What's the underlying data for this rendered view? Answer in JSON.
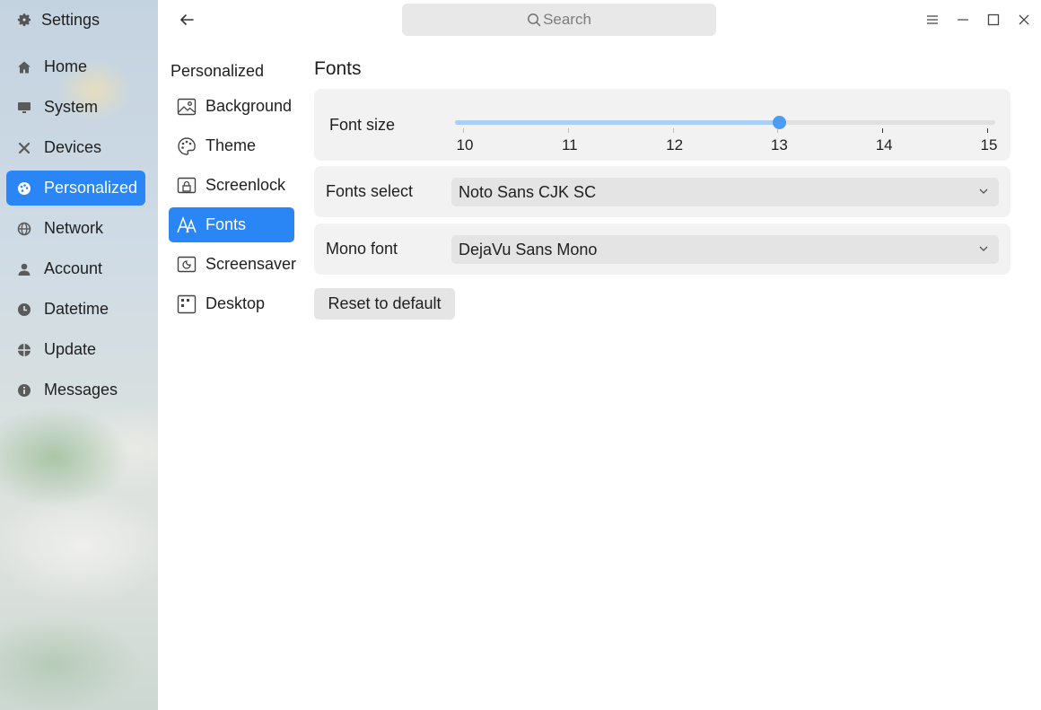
{
  "app": {
    "title": "Settings",
    "icon": "gear-icon"
  },
  "sidebar": {
    "items": [
      {
        "label": "Home",
        "icon": "home-icon"
      },
      {
        "label": "System",
        "icon": "monitor-icon"
      },
      {
        "label": "Devices",
        "icon": "tools-icon"
      },
      {
        "label": "Personalized",
        "icon": "palette-icon",
        "active": true
      },
      {
        "label": "Network",
        "icon": "globe-icon"
      },
      {
        "label": "Account",
        "icon": "user-icon"
      },
      {
        "label": "Datetime",
        "icon": "clock-icon"
      },
      {
        "label": "Update",
        "icon": "update-icon"
      },
      {
        "label": "Messages",
        "icon": "info-icon"
      }
    ]
  },
  "topbar": {
    "search_placeholder": "Search",
    "controls": [
      "menu-icon",
      "minimize-icon",
      "maximize-icon",
      "close-icon"
    ]
  },
  "subnav": {
    "title": "Personalized",
    "items": [
      {
        "label": "Background",
        "icon": "image-icon"
      },
      {
        "label": "Theme",
        "icon": "palette-icon"
      },
      {
        "label": "Screenlock",
        "icon": "screenlock-icon"
      },
      {
        "label": "Fonts",
        "icon": "font-icon",
        "active": true
      },
      {
        "label": "Screensaver",
        "icon": "screensaver-icon"
      },
      {
        "label": "Desktop",
        "icon": "desktop-grid-icon"
      }
    ]
  },
  "content": {
    "title": "Fonts",
    "font_size": {
      "label": "Font size",
      "ticks": [
        "10",
        "11",
        "12",
        "13",
        "14",
        "15"
      ],
      "min": 10,
      "max": 15,
      "value": 13
    },
    "fonts_select": {
      "label": "Fonts select",
      "value": "Noto Sans CJK SC"
    },
    "mono_font": {
      "label": "Mono font",
      "value": "DejaVu Sans Mono"
    },
    "reset_label": "Reset to default"
  },
  "colors": {
    "accent": "#2b86f5",
    "slider_fill": "#a9cef7",
    "slider_handle": "#4d9bf2"
  }
}
